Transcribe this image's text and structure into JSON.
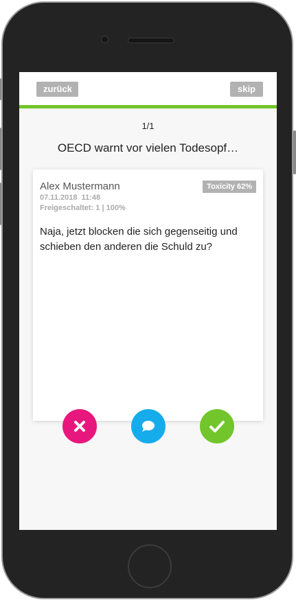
{
  "topbar": {
    "back_label": "zurück",
    "skip_label": "skip",
    "accent_color": "#72c52a"
  },
  "counter": "1/1",
  "article_title": "OECD warnt vor vielen Todesopf…",
  "comment": {
    "author": "Alex Mustermann",
    "date": "07.11.2018",
    "time": "11:48",
    "freigeschaltet": "Freigeschaltet: 1 | 100%",
    "toxicity_badge": "Toxicity 62%",
    "text": "Naja, jetzt blocken die sich gegenseitig und schieben den anderen die Schuld zu?"
  },
  "actions": [
    {
      "name": "reject",
      "icon": "close-icon",
      "color": "#e8177d"
    },
    {
      "name": "reply",
      "icon": "chat-bubble-icon",
      "color": "#16acec"
    },
    {
      "name": "approve",
      "icon": "checkmark-icon",
      "color": "#72c52a"
    }
  ]
}
